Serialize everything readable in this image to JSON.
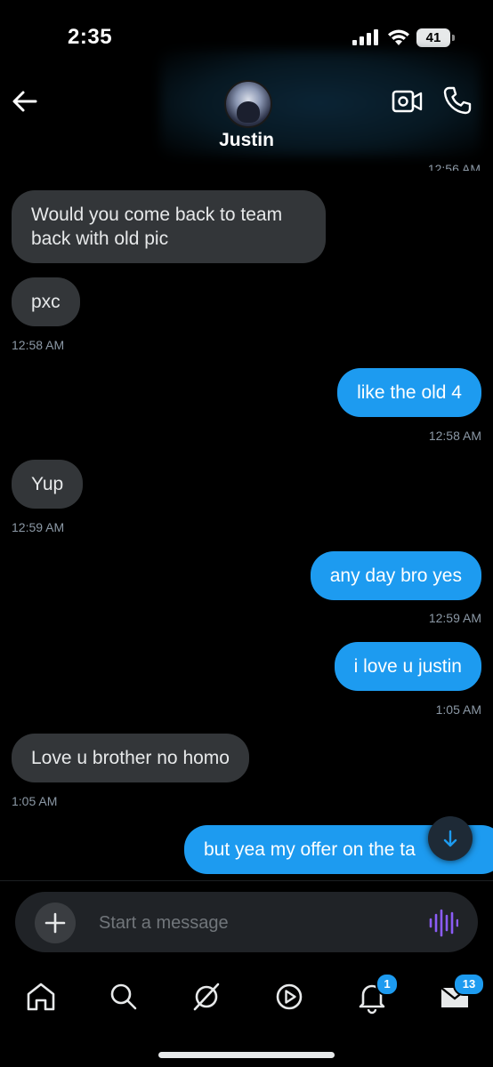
{
  "status_bar": {
    "time": "2:35",
    "battery": "41"
  },
  "header": {
    "contact_name": "Justin",
    "cut_timestamp": "12:56 AM"
  },
  "messages": [
    {
      "side": "in",
      "text": "Would you come back to team back with old pic"
    },
    {
      "side": "in",
      "text": "pxc",
      "time": "12:58 AM"
    },
    {
      "side": "out",
      "text": "like the old 4",
      "time": "12:58 AM"
    },
    {
      "side": "in",
      "text": "Yup",
      "time": "12:59 AM"
    },
    {
      "side": "out",
      "text": "any day bro yes",
      "time": "12:59 AM"
    },
    {
      "side": "out",
      "text": "i love u justin",
      "time": "1:05 AM"
    },
    {
      "side": "in",
      "text": "Love u brother no homo",
      "time": "1:05 AM"
    },
    {
      "side": "out",
      "text": "but yea my offer on the ta"
    }
  ],
  "composer": {
    "placeholder": "Start a message"
  },
  "tabbar": {
    "items": [
      "home-icon",
      "search-icon",
      "grok-icon",
      "video-icon",
      "bell-icon",
      "mail-icon"
    ],
    "notifications_badge": "1",
    "messages_badge": "13"
  },
  "colors": {
    "outgoing": "#1d9bf0",
    "incoming": "#333639",
    "background": "#000000",
    "voice_accent": "#8b5cf6"
  }
}
